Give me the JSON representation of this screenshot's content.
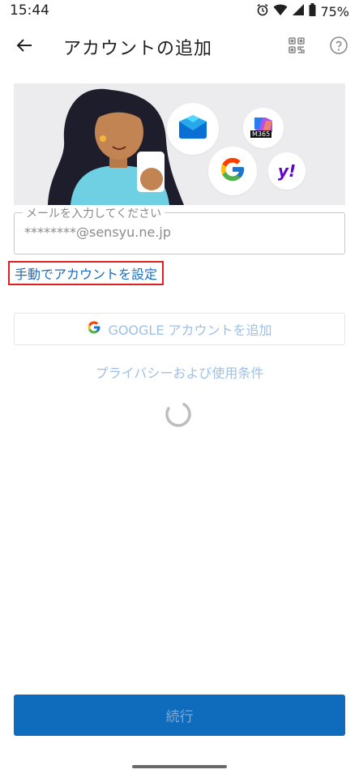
{
  "status_bar": {
    "time": "15:44",
    "battery": "75%"
  },
  "app_bar": {
    "title": "アカウントの追加"
  },
  "hero": {
    "m365_label": "M365",
    "yahoo_label": "y!"
  },
  "email_field": {
    "label": "メールを入力してください",
    "value": "********@sensyu.ne.jp"
  },
  "manual_link": {
    "label": "手動でアカウントを設定"
  },
  "google_button": {
    "label": "GOOGLE アカウントを追加"
  },
  "privacy_link": {
    "label": "プライバシーおよび使用条件"
  },
  "continue_button": {
    "label": "続行"
  },
  "colors": {
    "accent": "#0f6cbd",
    "link": "#1a6cc4",
    "highlight_border": "#e02020"
  }
}
